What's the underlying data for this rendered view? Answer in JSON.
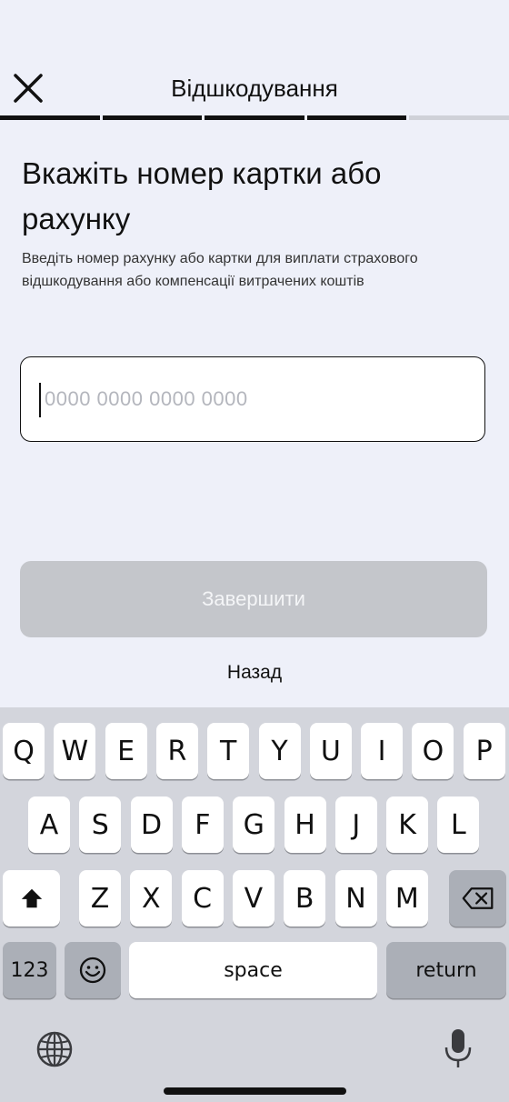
{
  "header": {
    "title": "Відшкодування",
    "progress": {
      "total_steps": 5,
      "completed_steps": 4
    }
  },
  "main": {
    "heading": "Вкажіть номер картки або рахунку",
    "subtext": "Введіть номер рахунку або картки для виплати страхового відшкодування або компенсації витрачених коштів",
    "card_input": {
      "value": "",
      "placeholder": "0000 0000 0000 0000"
    },
    "finish_button": "Завершити",
    "back_link": "Назад"
  },
  "keyboard": {
    "row1": [
      "Q",
      "W",
      "E",
      "R",
      "T",
      "Y",
      "U",
      "I",
      "O",
      "P"
    ],
    "row2": [
      "A",
      "S",
      "D",
      "F",
      "G",
      "H",
      "J",
      "K",
      "L"
    ],
    "row3": [
      "Z",
      "X",
      "C",
      "V",
      "B",
      "N",
      "M"
    ],
    "numbers_key": "123",
    "space_key": "space",
    "return_key": "return",
    "shift_icon": "shift-icon",
    "delete_icon": "backspace-icon",
    "emoji_icon": "emoji-icon",
    "globe_icon": "globe-icon",
    "mic_icon": "microphone-icon"
  },
  "colors": {
    "background": "#eef0f9",
    "progress_active": "#111111",
    "progress_inactive": "#cfd1d8",
    "button_disabled": "#c4c6cb",
    "keyboard_bg": "#d3d5dc"
  }
}
